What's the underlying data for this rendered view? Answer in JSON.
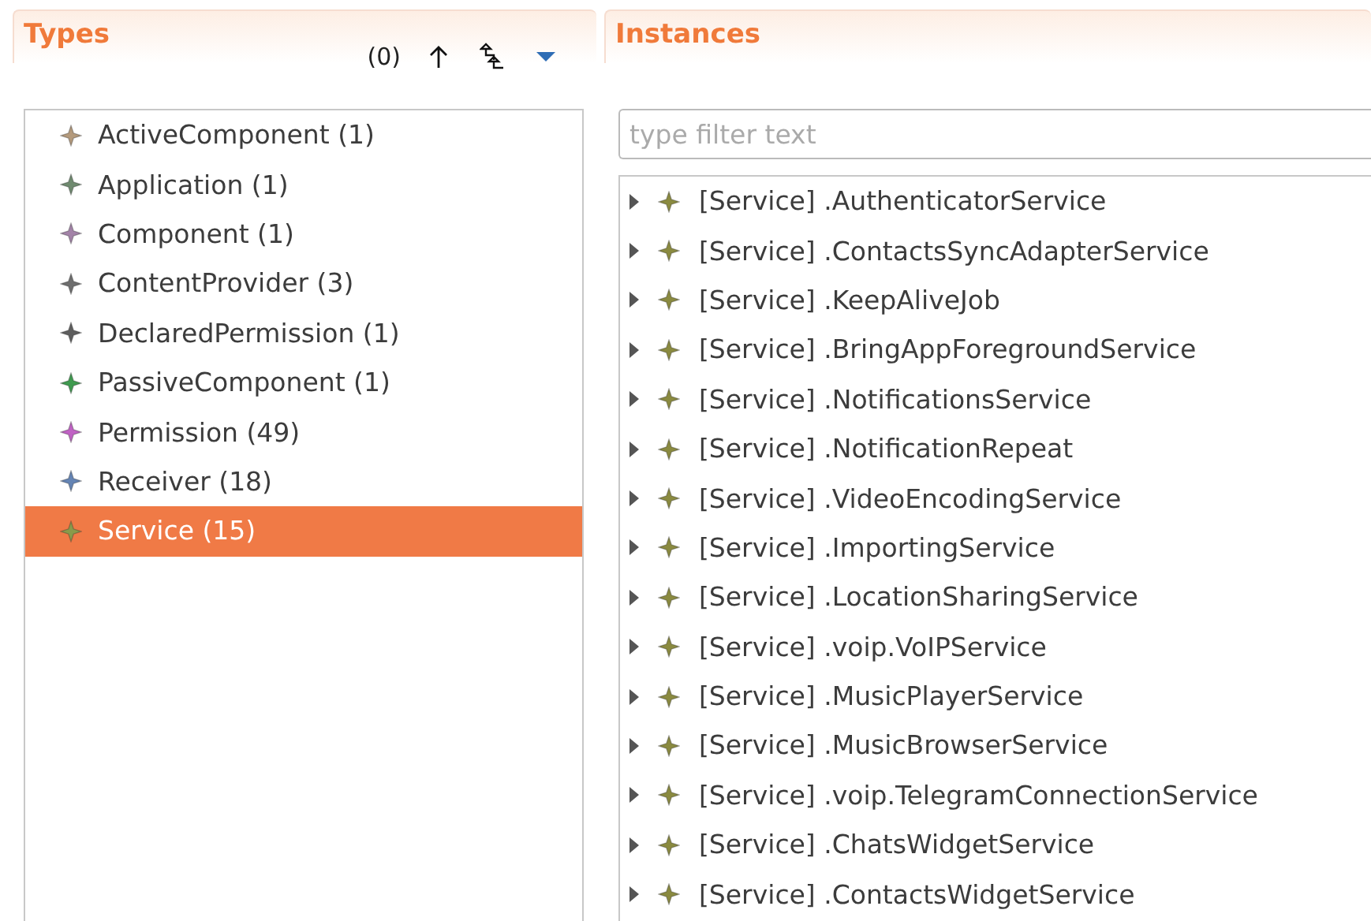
{
  "types_panel": {
    "title": "Types",
    "count": "(0)",
    "items": [
      {
        "label": "ActiveComponent (1)",
        "color": "#b49a7c",
        "selected": false
      },
      {
        "label": "Application (1)",
        "color": "#6f8a6f",
        "selected": false
      },
      {
        "label": "Component (1)",
        "color": "#a383a8",
        "selected": false
      },
      {
        "label": "ContentProvider (3)",
        "color": "#6e6e6e",
        "selected": false
      },
      {
        "label": "DeclaredPermission (1)",
        "color": "#5e5e5e",
        "selected": false
      },
      {
        "label": "PassiveComponent (1)",
        "color": "#3f9a4f",
        "selected": false
      },
      {
        "label": "Permission (49)",
        "color": "#c062c4",
        "selected": false
      },
      {
        "label": "Receiver (18)",
        "color": "#6484b4",
        "selected": false
      },
      {
        "label": "Service (15)",
        "color": "#8a9a4a",
        "selected": true
      }
    ]
  },
  "instances_panel": {
    "title": "Instances",
    "filter": {
      "placeholder": "type filter text"
    },
    "items": [
      {
        "label": "[Service] .AuthenticatorService",
        "expanded": false
      },
      {
        "label": "[Service] .ContactsSyncAdapterService",
        "expanded": false
      },
      {
        "label": "[Service] .KeepAliveJob",
        "expanded": false
      },
      {
        "label": "[Service] .BringAppForegroundService",
        "expanded": false
      },
      {
        "label": "[Service] .NotificationsService",
        "expanded": false
      },
      {
        "label": "[Service] .NotificationRepeat",
        "expanded": false
      },
      {
        "label": "[Service] .VideoEncodingService",
        "expanded": false
      },
      {
        "label": "[Service] .ImportingService",
        "expanded": false
      },
      {
        "label": "[Service] .LocationSharingService",
        "expanded": false
      },
      {
        "label": "[Service] .voip.VoIPService",
        "expanded": false
      },
      {
        "label": "[Service] .MusicPlayerService",
        "expanded": false
      },
      {
        "label": "[Service] .MusicBrowserService",
        "expanded": false
      },
      {
        "label": "[Service] .voip.TelegramConnectionService",
        "expanded": false
      },
      {
        "label": "[Service] .ChatsWidgetService",
        "expanded": false
      },
      {
        "label": "[Service] .ContactsWidgetService",
        "expanded": false
      }
    ]
  }
}
